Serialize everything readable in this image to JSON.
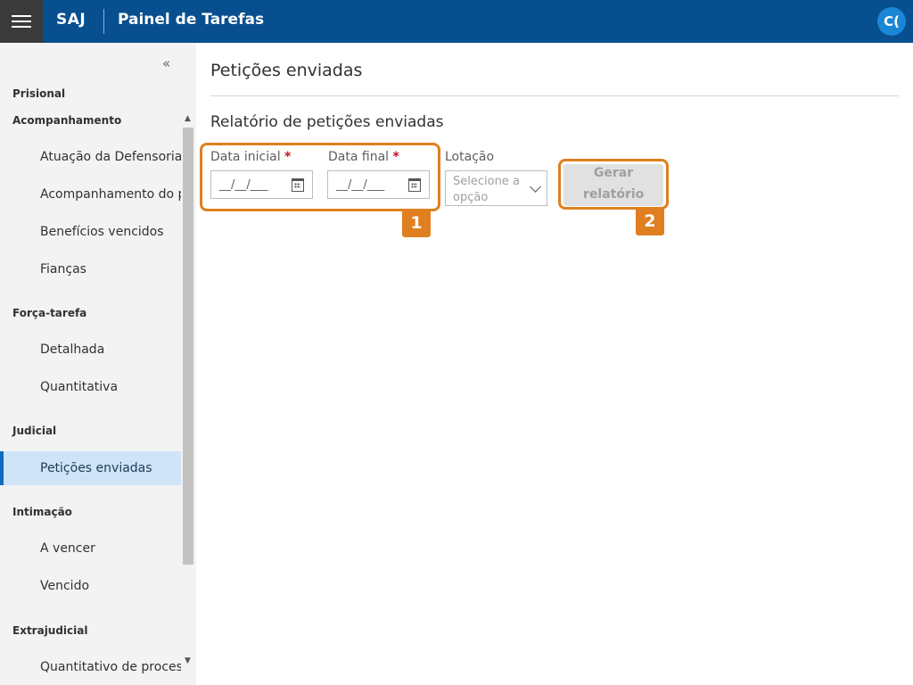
{
  "header": {
    "brand": "SAJ",
    "title": "Painel de Tarefas",
    "avatar_initials": "C("
  },
  "sidebar": {
    "collapse_glyph": "«",
    "sections": {
      "prisional": "Prisional",
      "acompanhamento": "Acompanhamento",
      "forca_tarefa": "Força-tarefa",
      "judicial": "Judicial",
      "intimacao": "Intimação",
      "extrajudicial": "Extrajudicial"
    },
    "items": {
      "atuacao": "Atuação da Defensoria",
      "acompanhamento_pre": "Acompanhamento do pre",
      "beneficios": "Benefícios vencidos",
      "fiancas": "Fianças",
      "detalhada": "Detalhada",
      "quantitativa": "Quantitativa",
      "peticoes": "Petições enviadas",
      "a_vencer": "A vencer",
      "vencido": "Vencido",
      "quantitativo_processo": "Quantitativo de processo"
    }
  },
  "main": {
    "page_title": "Petições enviadas",
    "section_title": "Relatório de petições enviadas",
    "form": {
      "data_inicial_label": "Data inicial",
      "data_final_label": "Data final",
      "required_mark": "*",
      "date_placeholder": "__/__/___",
      "lotacao_label": "Lotação",
      "lotacao_placeholder": "Selecione a opção",
      "generate_button": "Gerar relatório"
    }
  },
  "annotations": {
    "badge_1": "1",
    "badge_2": "2",
    "color": "#e07f1f"
  },
  "colors": {
    "header_bg": "#084f8f",
    "active_item_bg": "#cfe4f7",
    "active_item_border": "#0f6cbd"
  }
}
